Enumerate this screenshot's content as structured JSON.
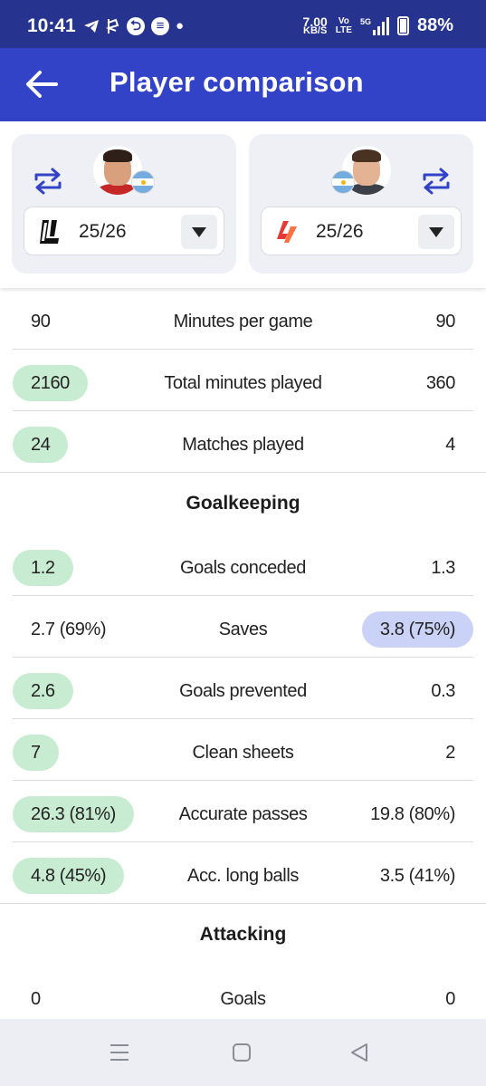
{
  "status_bar": {
    "time": "10:41",
    "net_speed_value": "7.00",
    "net_speed_unit": "KB/S",
    "volte_top": "Vo",
    "volte_bottom": "LTE",
    "network": "5G",
    "battery": "88%"
  },
  "app_bar": {
    "title": "Player comparison",
    "back_icon": "arrow-left-icon"
  },
  "players": [
    {
      "season": "25/26",
      "league_icon": "ligue1-logo",
      "flag": "argentina-flag",
      "swap_icon": "swap-icon"
    },
    {
      "season": "25/26",
      "league_icon": "laliga-logo",
      "flag": "argentina-flag",
      "swap_icon": "swap-icon"
    }
  ],
  "general_stats": [
    {
      "label": "Minutes per game",
      "left": "90",
      "right": "90",
      "highlight": "none"
    },
    {
      "label": "Total minutes played",
      "left": "2160",
      "right": "360",
      "highlight": "left"
    },
    {
      "label": "Matches played",
      "left": "24",
      "right": "4",
      "highlight": "left"
    }
  ],
  "goalkeeping": {
    "title": "Goalkeeping",
    "stats": [
      {
        "label": "Goals conceded",
        "left": "1.2",
        "right": "1.3",
        "highlight": "left"
      },
      {
        "label": "Saves",
        "left": "2.7 (69%)",
        "right": "3.8 (75%)",
        "highlight": "right"
      },
      {
        "label": "Goals prevented",
        "left": "2.6",
        "right": "0.3",
        "highlight": "left"
      },
      {
        "label": "Clean sheets",
        "left": "7",
        "right": "2",
        "highlight": "left"
      },
      {
        "label": "Accurate passes",
        "left": "26.3 (81%)",
        "right": "19.8 (80%)",
        "highlight": "left"
      },
      {
        "label": "Acc. long balls",
        "left": "4.8 (45%)",
        "right": "3.5 (41%)",
        "highlight": "left"
      }
    ]
  },
  "attacking": {
    "title": "Attacking",
    "stats": [
      {
        "label": "Goals",
        "left": "0",
        "right": "0",
        "highlight": "none"
      }
    ]
  },
  "colors": {
    "status_bar": "#26338f",
    "app_bar": "#3343c7",
    "left_highlight": "#c8ecd1",
    "right_highlight": "#cbd2f7",
    "swap_icon": "#3343c7"
  }
}
